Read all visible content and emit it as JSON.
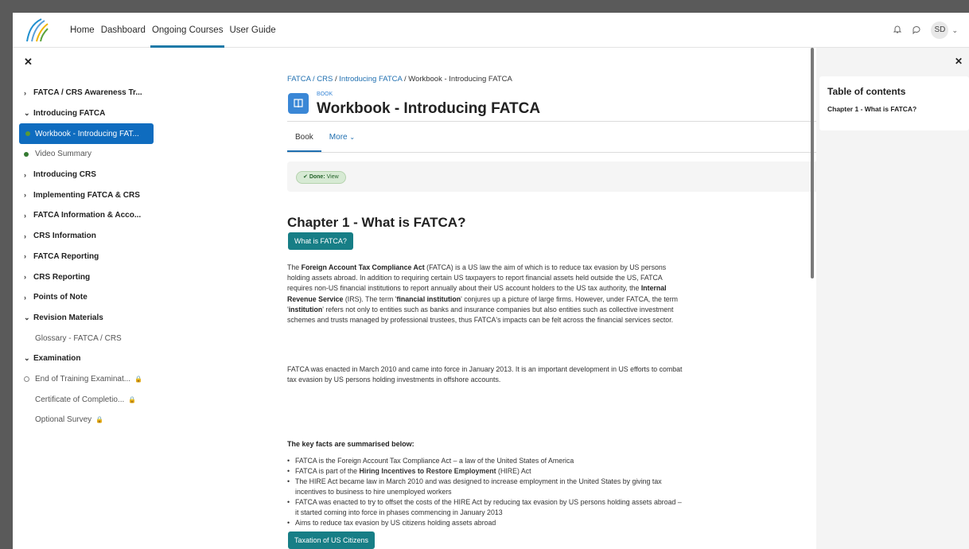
{
  "nav": {
    "links": [
      "Home",
      "Dashboard",
      "Ongoing Courses",
      "User Guide"
    ],
    "active": "Ongoing Courses",
    "avatar_initials": "SD"
  },
  "course_index": [
    {
      "label": "FATCA / CRS Awareness Tr...",
      "kind": "section",
      "chevron": ">"
    },
    {
      "label": "Introducing FATCA",
      "kind": "section",
      "chevron": "v"
    },
    {
      "label": "Workbook - Introducing FAT...",
      "kind": "current"
    },
    {
      "label": "Video Summary",
      "kind": "done"
    },
    {
      "label": "Introducing CRS",
      "kind": "section",
      "chevron": ">"
    },
    {
      "label": "Implementing FATCA & CRS",
      "kind": "section",
      "chevron": ">"
    },
    {
      "label": "FATCA Information & Acco...",
      "kind": "section",
      "chevron": ">"
    },
    {
      "label": "CRS Information",
      "kind": "section",
      "chevron": ">"
    },
    {
      "label": "FATCA Reporting",
      "kind": "section",
      "chevron": ">"
    },
    {
      "label": "CRS Reporting",
      "kind": "section",
      "chevron": ">"
    },
    {
      "label": "Points of Note",
      "kind": "section",
      "chevron": ">"
    },
    {
      "label": "Revision Materials",
      "kind": "section",
      "chevron": "v"
    },
    {
      "label": "Glossary - FATCA / CRS",
      "kind": "sub"
    },
    {
      "label": "Examination",
      "kind": "section",
      "chevron": "v"
    },
    {
      "label": "End of Training Examinat...",
      "kind": "open",
      "locked": true
    },
    {
      "label": "Certificate of Completio...",
      "kind": "sub",
      "locked": true
    },
    {
      "label": "Optional Survey",
      "kind": "sub",
      "locked": true
    }
  ],
  "breadcrumb": {
    "items": [
      "FATCA / CRS",
      "Introducing FATCA"
    ],
    "current": "Workbook - Introducing FATCA"
  },
  "header": {
    "module_type": "BOOK",
    "title": "Workbook - Introducing FATCA"
  },
  "tabs": {
    "book": "Book",
    "more": "More"
  },
  "completion": {
    "label": "Done:",
    "value": "View"
  },
  "chapter": {
    "title": "Chapter 1 - What is FATCA?",
    "button1": "What is FATCA?",
    "button2": "Taxation of US Citizens"
  },
  "para1": {
    "t1": "The ",
    "b1": "Foreign Account Tax Compliance Act",
    "t2": " (FATCA) is a US law the aim of which is to reduce tax evasion by US persons holding assets abroad. In addition to requiring certain US taxpayers to report financial assets held outside the US, FATCA requires non-US financial institutions to report annually about their US account holders to the US tax authority, the ",
    "b2": "Internal Revenue Service",
    "t3": " (IRS). The term '",
    "b3": "financial institution",
    "t4": "' conjures up a picture of large firms. However, under FATCA, the term '",
    "b4": "institution",
    "t5": "' refers not only to entities such as banks and insurance companies but also entities such as collective investment schemes and trusts managed by professional trustees, thus FATCA's impacts can be felt across the financial services sector."
  },
  "para2": "FATCA was enacted in March 2010 and came into force in January 2013. It is an important development in US efforts to combat tax evasion by US persons holding investments in offshore accounts.",
  "key_facts": {
    "heading": "The key facts are summarised below:",
    "b1": "FATCA is the Foreign Account Tax Compliance Act – a law of the United States of America",
    "b2a": "FATCA is part of the ",
    "b2b": "Hiring Incentives to Restore Employment",
    "b2c": " (HIRE) Act",
    "b3": "The HIRE Act became law in March 2010 and was designed to increase employment in the United States by giving tax incentives to business to hire unemployed workers",
    "b4": "FATCA was enacted to try to offset the costs of the HIRE Act by reducing tax evasion by US persons holding assets abroad – it started coming into force in phases commencing in January 2013",
    "b5": "Aims to reduce tax evasion by US citizens holding assets abroad"
  },
  "toc": {
    "title": "Table of contents",
    "item": "Chapter 1 - What is FATCA?"
  }
}
